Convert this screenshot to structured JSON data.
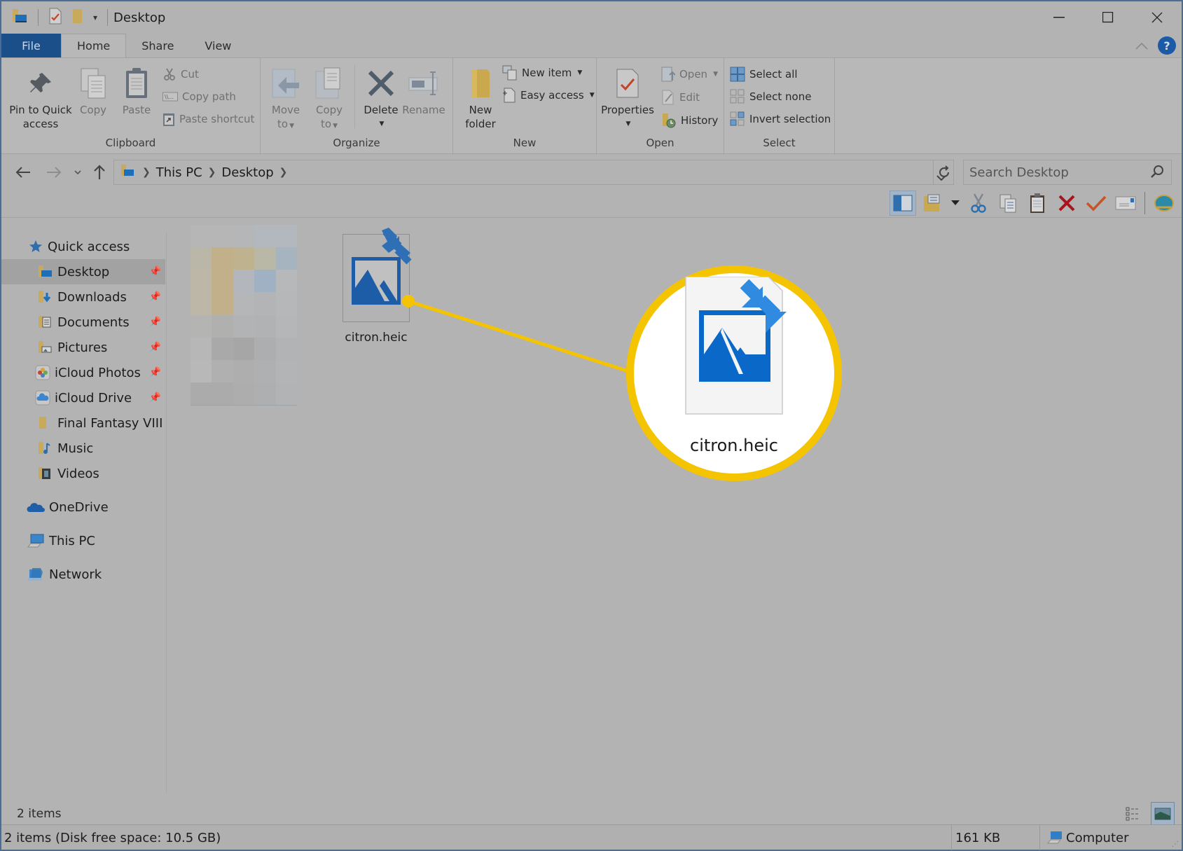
{
  "window": {
    "title": "Desktop",
    "controls": {
      "minimize": "—",
      "maximize": "☐",
      "close": "✕"
    }
  },
  "ribbon_tabs": [
    {
      "label": "File",
      "type": "file"
    },
    {
      "label": "Home",
      "active": true
    },
    {
      "label": "Share"
    },
    {
      "label": "View"
    }
  ],
  "ribbon": {
    "clipboard": {
      "label": "Clipboard",
      "pin": "Pin to Quick access",
      "pin_line1": "Pin to Quick",
      "pin_line2": "access",
      "copy": "Copy",
      "paste": "Paste",
      "cut": "Cut",
      "copy_path": "Copy path",
      "paste_shortcut": "Paste shortcut"
    },
    "organize": {
      "label": "Organize",
      "move_to_line1": "Move",
      "move_to_line2": "to",
      "copy_to_line1": "Copy",
      "copy_to_line2": "to",
      "delete": "Delete",
      "rename": "Rename"
    },
    "new": {
      "label": "New",
      "new_folder_line1": "New",
      "new_folder_line2": "folder",
      "new_item": "New item",
      "easy_access": "Easy access"
    },
    "open": {
      "label": "Open",
      "properties": "Properties",
      "open": "Open",
      "edit": "Edit",
      "history": "History"
    },
    "select": {
      "label": "Select",
      "select_all": "Select all",
      "select_none": "Select none",
      "invert_selection": "Invert selection"
    }
  },
  "address_bar": {
    "breadcrumbs": [
      "This PC",
      "Desktop"
    ],
    "search_placeholder": "Search Desktop"
  },
  "toolbar_icons": [
    "preview-pane-icon",
    "properties-folder-icon",
    "dropdown-arrow-icon",
    "cut-icon",
    "copy-icon",
    "paste-icon",
    "delete-icon",
    "checkmark-icon",
    "email-icon",
    "shell-icon"
  ],
  "nav_pane": {
    "quick_access": "Quick access",
    "items": [
      {
        "label": "Desktop",
        "pinned": true,
        "selected": true,
        "icon": "desktop-folder-icon"
      },
      {
        "label": "Downloads",
        "pinned": true,
        "icon": "downloads-folder-icon"
      },
      {
        "label": "Documents",
        "pinned": true,
        "icon": "documents-folder-icon"
      },
      {
        "label": "Pictures",
        "pinned": true,
        "icon": "pictures-folder-icon"
      },
      {
        "label": "iCloud Photos",
        "pinned": true,
        "icon": "icloud-photos-icon"
      },
      {
        "label": "iCloud Drive",
        "pinned": true,
        "icon": "icloud-drive-icon"
      },
      {
        "label": "Final Fantasy VIII",
        "pinned": false,
        "icon": "folder-icon"
      },
      {
        "label": "Music",
        "pinned": false,
        "icon": "music-folder-icon"
      },
      {
        "label": "Videos",
        "pinned": false,
        "icon": "videos-folder-icon"
      }
    ],
    "onedrive": "OneDrive",
    "this_pc": "This PC",
    "network": "Network"
  },
  "content": {
    "files": [
      {
        "name": "citron.heic",
        "type": "heic-image"
      }
    ],
    "magnified_label": "citron.heic",
    "highlight_color": "#f5c400"
  },
  "footer": {
    "item_count": "2 items",
    "status_text": "2 items (Disk free space: 10.5 GB)",
    "size": "161 KB",
    "location": "Computer"
  }
}
